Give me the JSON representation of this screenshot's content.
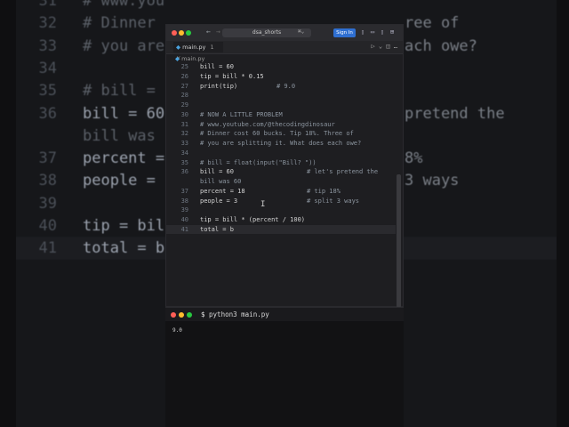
{
  "background_editor": {
    "lines": [
      {
        "num": "31",
        "code": "# www.you",
        "right": ""
      },
      {
        "num": "32",
        "code": "# Dinner",
        "right": "ree of"
      },
      {
        "num": "33",
        "code": "# you are",
        "right": "ach owe?"
      },
      {
        "num": "34",
        "code": "",
        "right": ""
      },
      {
        "num": "35",
        "code": "# bill =",
        "right": ""
      },
      {
        "num": "36",
        "code": "bill = 60",
        "right": "pretend the"
      },
      {
        "num": "",
        "code": "bill was",
        "right": ""
      },
      {
        "num": "37",
        "code": "percent =",
        "right": "8%"
      },
      {
        "num": "38",
        "code": "people =",
        "right": "3 ways"
      },
      {
        "num": "39",
        "code": "",
        "right": ""
      },
      {
        "num": "40",
        "code": "tip = bil",
        "right": ""
      },
      {
        "num": "41",
        "code": "total = b",
        "right": ""
      }
    ]
  },
  "window": {
    "search_text": "dsa_shorts",
    "sign_in_label": "Sign In",
    "tab": {
      "label": "main.py",
      "badge": "1",
      "close": "×"
    },
    "breadcrumb": "main.py",
    "colors": {
      "accent": "#2f6fd1",
      "bg": "#1e1e21"
    }
  },
  "code_lines": [
    {
      "num": "25",
      "code": "bill = 60",
      "comment": ""
    },
    {
      "num": "26",
      "code": "tip = bill * 0.15",
      "comment": ""
    },
    {
      "num": "27",
      "code": "print(tip)",
      "comment": "# 9.0"
    },
    {
      "num": "28",
      "code": "",
      "comment": ""
    },
    {
      "num": "29",
      "code": "",
      "comment": ""
    },
    {
      "num": "30",
      "code": "# NOW A LITTLE PROBLEM",
      "comment": ""
    },
    {
      "num": "31",
      "code": "# www.youtube.com/@thecodingdinosaur",
      "comment": ""
    },
    {
      "num": "32",
      "code": "# Dinner cost 60 bucks. Tip 18%. Three of",
      "comment": ""
    },
    {
      "num": "33",
      "code": "# you are splitting it. What does each owe?",
      "comment": ""
    },
    {
      "num": "34",
      "code": "",
      "comment": ""
    },
    {
      "num": "35",
      "code": "# bill = float(input(\"Bill? \"))",
      "comment": ""
    },
    {
      "num": "36",
      "code": "bill = 60",
      "comment": "# let's pretend the"
    },
    {
      "num": "",
      "code": "bill was 60",
      "comment": ""
    },
    {
      "num": "37",
      "code": "percent = 18",
      "comment": "# tip 18%"
    },
    {
      "num": "38",
      "code": "people = 3",
      "comment": "# split 3 ways"
    },
    {
      "num": "39",
      "code": "",
      "comment": ""
    },
    {
      "num": "40",
      "code": "tip = bill * (percent / 100)",
      "comment": ""
    },
    {
      "num": "41",
      "code": "total = b",
      "comment": ""
    }
  ],
  "terminal": {
    "prompt": "$",
    "command": "python3 main.py",
    "output": "9.0"
  }
}
